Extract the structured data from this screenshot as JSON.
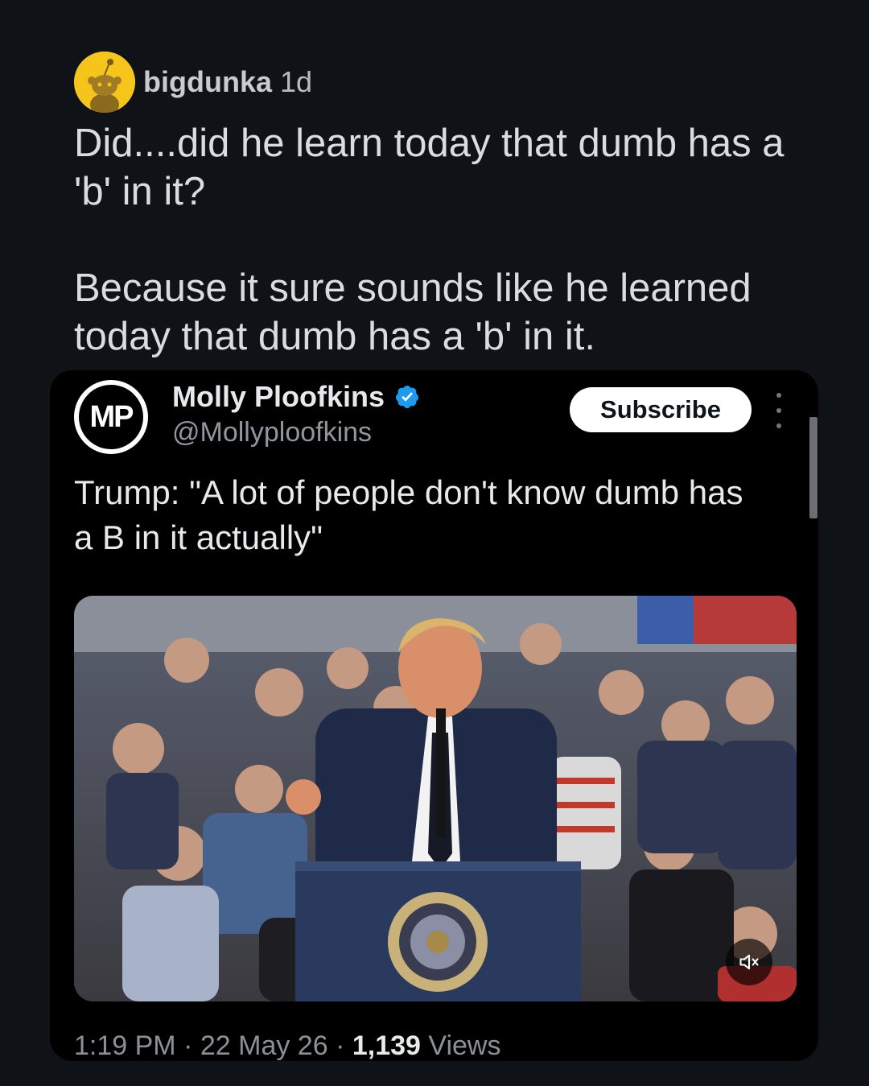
{
  "comment": {
    "username": "bigdunka",
    "age": "1d",
    "avatar_icon": "snoo-avatar-icon",
    "paragraphs": [
      "Did....did he learn today that dumb has a 'b' in it?",
      "Because it sure sounds like he learned today that dumb has a 'b' in it."
    ]
  },
  "tweet": {
    "author_name": "Molly Ploofkins",
    "author_handle": "@Mollyploofkins",
    "avatar_initials": "MP",
    "verified_icon": "verified-badge-icon",
    "subscribe_label": "Subscribe",
    "text": "Trump: \"A lot of people don't know dumb has a B in it actually\"",
    "media_icon": "mute-icon",
    "time": "1:19 PM",
    "separator": "·",
    "date": "22 May 26",
    "views_count": "1,139",
    "views_label": "Views"
  },
  "colors": {
    "background": "#0f1318",
    "card": "#000000",
    "verified_blue": "#1d9bf0",
    "avatar_yellow": "#f5c51b"
  }
}
